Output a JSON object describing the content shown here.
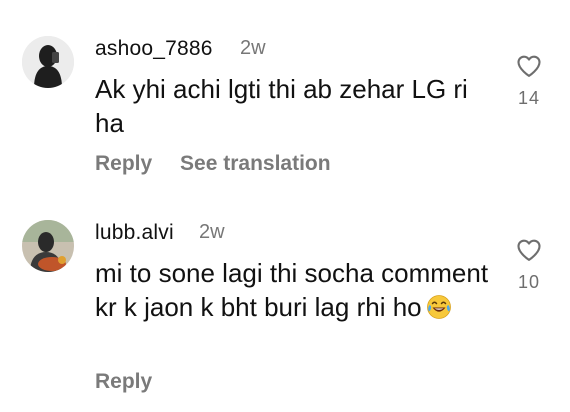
{
  "comments": [
    {
      "username": "ashoo_7886",
      "time": "2w",
      "text": "Ak yhi achi lgti thi ab zehar LG ri ha",
      "like_count": "14",
      "reply_label": "Reply",
      "translate_label": "See translation",
      "avatar_icon": "user-avatar"
    },
    {
      "username": "lubb.alvi",
      "time": "2w",
      "text": "mi to sone lagi thi socha comment kr k jaon k bht buri lag rhi ho",
      "emoji": "face-with-tears-of-joy",
      "like_count": "10",
      "reply_label": "Reply",
      "avatar_icon": "user-avatar"
    }
  ],
  "colors": {
    "text": "#111111",
    "muted": "#777777",
    "icon": "#6e6e6e",
    "background": "#ffffff"
  }
}
